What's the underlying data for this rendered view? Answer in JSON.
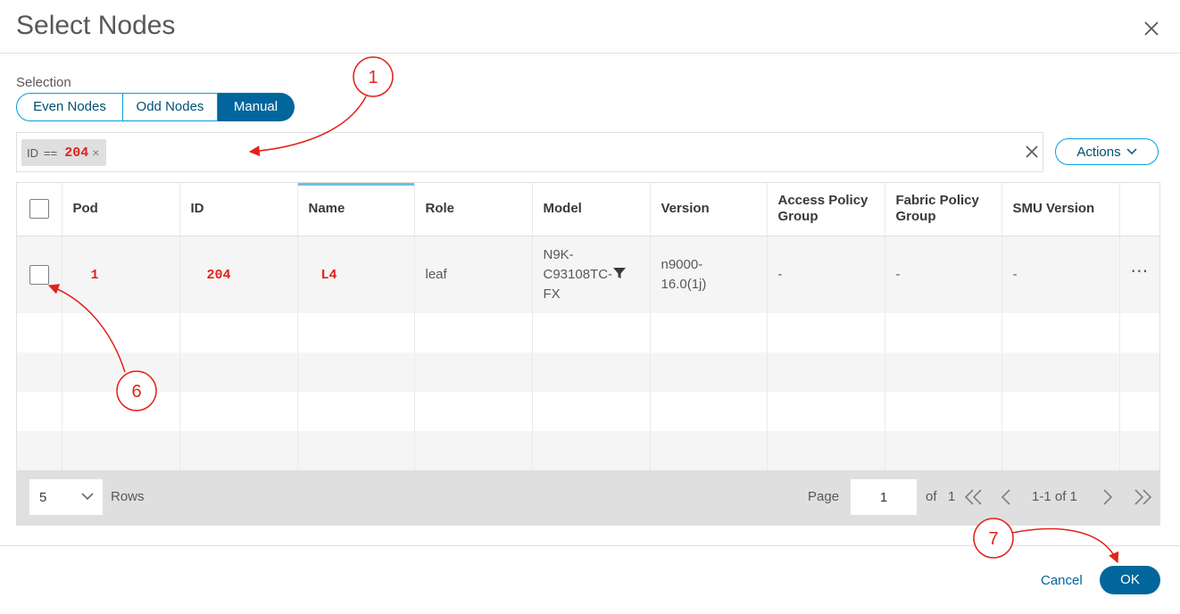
{
  "dialog": {
    "title": "Select Nodes",
    "close_icon": "close-icon"
  },
  "selection": {
    "label": "Selection",
    "options": [
      "Even Nodes",
      "Odd Nodes",
      "Manual"
    ],
    "selected": "Manual"
  },
  "filter": {
    "chip_key": "ID",
    "chip_op": "==",
    "chip_value": "204",
    "chip_remove": "×",
    "clear_icon": "close-icon"
  },
  "actions": {
    "label": "Actions",
    "icon": "chevron-down-icon"
  },
  "table": {
    "columns": [
      "Pod",
      "ID",
      "Name",
      "Role",
      "Model",
      "Version",
      "Access Policy Group",
      "Fabric Policy Group",
      "SMU Version"
    ],
    "sorted_column": "Name",
    "rows": [
      {
        "pod": "1",
        "id": "204",
        "name": "L4",
        "role": "leaf",
        "model_line1": "N9K-",
        "model_line2": "C93108TC-",
        "model_line3": "FX",
        "version_line1": "n9000-",
        "version_line2": "16.0(1j)",
        "access_policy_group": "-",
        "fabric_policy_group": "-",
        "smu_version": "-",
        "more": "⋯"
      }
    ]
  },
  "pagination": {
    "rows_per_page": "5",
    "rows_label": "Rows",
    "page_label": "Page",
    "page_value": "1",
    "of_label": "of",
    "total_pages": "1",
    "range": "1-1 of 1"
  },
  "footer": {
    "cancel": "Cancel",
    "ok": "OK"
  },
  "annotations": [
    {
      "number": "1"
    },
    {
      "number": "6"
    },
    {
      "number": "7"
    }
  ],
  "colors": {
    "accent": "#00669c",
    "accent_light": "#049fd9",
    "annotation": "#e2231a"
  }
}
